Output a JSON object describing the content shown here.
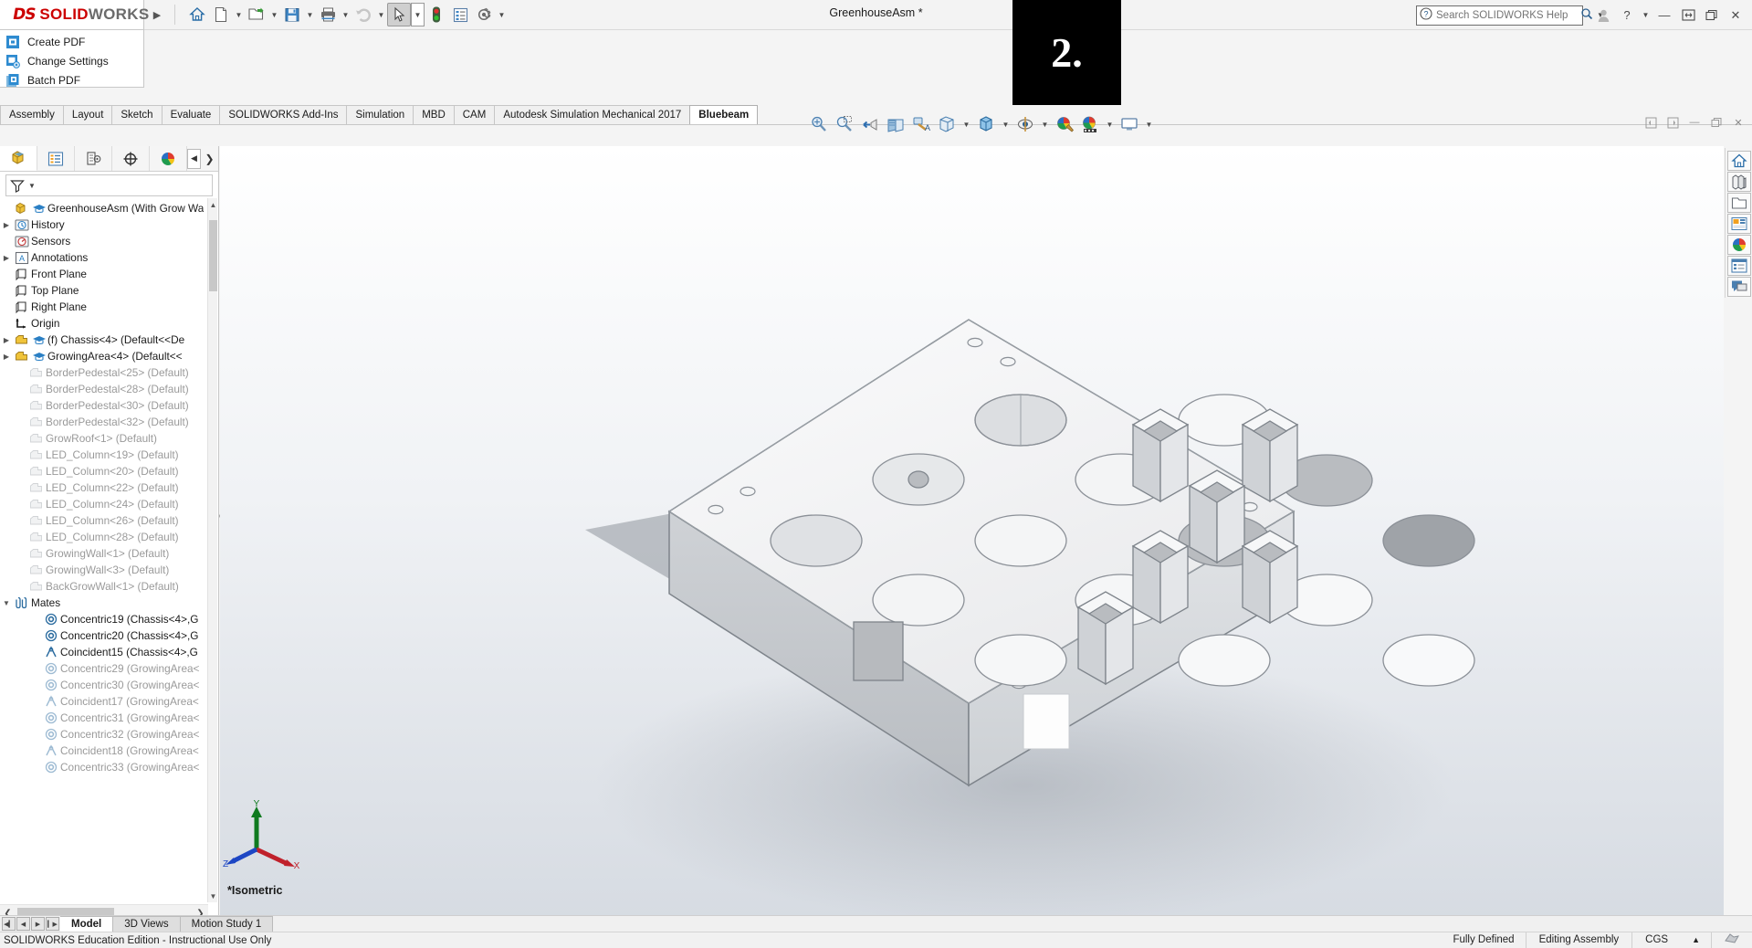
{
  "window": {
    "brand_ds": "DS",
    "brand_solid": "SOLID",
    "brand_works": "WORKS",
    "document_title": "GreenhouseAsm *",
    "search_placeholder": "Search SOLIDWORKS Help",
    "overlay_badge": "2."
  },
  "logo_menu": {
    "items": [
      {
        "label": "Create PDF",
        "icon": "pdf-document-icon"
      },
      {
        "label": "Change Settings",
        "icon": "settings-gear-icon"
      },
      {
        "label": "Batch PDF",
        "icon": "batch-pdf-icon"
      }
    ]
  },
  "main_toolbar": {
    "buttons": [
      {
        "name": "home-icon",
        "tooltip": "Home"
      },
      {
        "name": "new-document-icon",
        "tooltip": "New"
      },
      {
        "name": "open-folder-icon",
        "tooltip": "Open"
      },
      {
        "name": "save-icon",
        "tooltip": "Save"
      },
      {
        "name": "print-icon",
        "tooltip": "Print"
      },
      {
        "name": "undo-icon",
        "tooltip": "Undo"
      },
      {
        "name": "select-cursor-icon",
        "tooltip": "Select"
      },
      {
        "name": "rebuild-traffic-light-icon",
        "tooltip": "Rebuild"
      },
      {
        "name": "options-list-icon",
        "tooltip": "Options"
      },
      {
        "name": "settings-gear-icon",
        "tooltip": "Settings"
      }
    ]
  },
  "command_tabs": {
    "items": [
      {
        "label": "Assembly",
        "active": false
      },
      {
        "label": "Layout",
        "active": false
      },
      {
        "label": "Sketch",
        "active": false
      },
      {
        "label": "Evaluate",
        "active": false
      },
      {
        "label": "SOLIDWORKS Add-Ins",
        "active": false
      },
      {
        "label": "Simulation",
        "active": false
      },
      {
        "label": "MBD",
        "active": false
      },
      {
        "label": "CAM",
        "active": false
      },
      {
        "label": "Autodesk Simulation Mechanical 2017",
        "active": false
      },
      {
        "label": "Bluebeam",
        "active": true
      }
    ]
  },
  "view_toolbar": {
    "buttons": [
      {
        "name": "zoom-to-fit-icon"
      },
      {
        "name": "zoom-to-area-icon"
      },
      {
        "name": "previous-view-icon"
      },
      {
        "name": "section-view-icon"
      },
      {
        "name": "view-orientation-paint-icon"
      },
      {
        "name": "view-orientation-cube-icon"
      },
      {
        "name": "display-style-icon"
      },
      {
        "name": "hide-show-items-icon"
      },
      {
        "name": "edit-appearance-icon"
      },
      {
        "name": "apply-scene-icon"
      },
      {
        "name": "view-settings-icon"
      }
    ]
  },
  "document_window_buttons": [
    {
      "name": "restore-left-icon"
    },
    {
      "name": "restore-right-icon"
    },
    {
      "name": "minimize-icon"
    },
    {
      "name": "maximize-icon"
    },
    {
      "name": "close-icon"
    }
  ],
  "feature_manager": {
    "tabs": [
      {
        "name": "feature-manager-tree-tab",
        "active": true
      },
      {
        "name": "property-manager-tab",
        "active": false
      },
      {
        "name": "configuration-manager-tab",
        "active": false
      },
      {
        "name": "dimxpert-manager-tab",
        "active": false
      },
      {
        "name": "display-manager-tab",
        "active": false
      }
    ],
    "filter_placeholder": "",
    "tree": [
      {
        "label": "GreenhouseAsm  (With Grow Wa",
        "icon": "assembly-icon",
        "icon2": "education-cap-icon",
        "expandable": false,
        "indent": 0,
        "dim": false
      },
      {
        "label": "History",
        "icon": "history-icon",
        "expandable": true,
        "indent": 0,
        "dim": false
      },
      {
        "label": "Sensors",
        "icon": "sensors-icon",
        "expandable": false,
        "indent": 0,
        "dim": false
      },
      {
        "label": "Annotations",
        "icon": "annotations-icon",
        "expandable": true,
        "indent": 0,
        "dim": false
      },
      {
        "label": "Front Plane",
        "icon": "plane-icon",
        "expandable": false,
        "indent": 0,
        "dim": false
      },
      {
        "label": "Top Plane",
        "icon": "plane-icon",
        "expandable": false,
        "indent": 0,
        "dim": false
      },
      {
        "label": "Right Plane",
        "icon": "plane-icon",
        "expandable": false,
        "indent": 0,
        "dim": false
      },
      {
        "label": "Origin",
        "icon": "origin-icon",
        "expandable": false,
        "indent": 0,
        "dim": false
      },
      {
        "label": "(f) Chassis<4> (Default<<De",
        "icon": "part-icon",
        "icon2": "education-cap-icon",
        "expandable": true,
        "indent": 0,
        "dim": false
      },
      {
        "label": "GrowingArea<4> (Default<<",
        "icon": "part-icon",
        "icon2": "education-cap-icon",
        "expandable": true,
        "indent": 0,
        "dim": false
      },
      {
        "label": "BorderPedestal<25> (Default)",
        "icon": "part-gray-icon",
        "expandable": false,
        "indent": 1,
        "dim": true
      },
      {
        "label": "BorderPedestal<28> (Default)",
        "icon": "part-gray-icon",
        "expandable": false,
        "indent": 1,
        "dim": true
      },
      {
        "label": "BorderPedestal<30> (Default)",
        "icon": "part-gray-icon",
        "expandable": false,
        "indent": 1,
        "dim": true
      },
      {
        "label": "BorderPedestal<32> (Default)",
        "icon": "part-gray-icon",
        "expandable": false,
        "indent": 1,
        "dim": true
      },
      {
        "label": "GrowRoof<1> (Default)",
        "icon": "part-gray-icon",
        "expandable": false,
        "indent": 1,
        "dim": true
      },
      {
        "label": "LED_Column<19> (Default)",
        "icon": "part-gray-icon",
        "expandable": false,
        "indent": 1,
        "dim": true
      },
      {
        "label": "LED_Column<20> (Default)",
        "icon": "part-gray-icon",
        "expandable": false,
        "indent": 1,
        "dim": true
      },
      {
        "label": "LED_Column<22> (Default)",
        "icon": "part-gray-icon",
        "expandable": false,
        "indent": 1,
        "dim": true
      },
      {
        "label": "LED_Column<24> (Default)",
        "icon": "part-gray-icon",
        "expandable": false,
        "indent": 1,
        "dim": true
      },
      {
        "label": "LED_Column<26> (Default)",
        "icon": "part-gray-icon",
        "expandable": false,
        "indent": 1,
        "dim": true
      },
      {
        "label": "LED_Column<28> (Default)",
        "icon": "part-gray-icon",
        "expandable": false,
        "indent": 1,
        "dim": true
      },
      {
        "label": "GrowingWall<1> (Default)",
        "icon": "part-gray-icon",
        "expandable": false,
        "indent": 1,
        "dim": true
      },
      {
        "label": "GrowingWall<3> (Default)",
        "icon": "part-gray-icon",
        "expandable": false,
        "indent": 1,
        "dim": true
      },
      {
        "label": "BackGrowWall<1> (Default)",
        "icon": "part-gray-icon",
        "expandable": false,
        "indent": 1,
        "dim": true
      },
      {
        "label": "Mates",
        "icon": "mates-icon",
        "expandable": true,
        "expanded": true,
        "indent": 0,
        "dim": false
      },
      {
        "label": "Concentric19 (Chassis<4>,G",
        "icon": "concentric-mate-icon",
        "expandable": false,
        "indent": 2,
        "dim": false
      },
      {
        "label": "Concentric20 (Chassis<4>,G",
        "icon": "concentric-mate-icon",
        "expandable": false,
        "indent": 2,
        "dim": false
      },
      {
        "label": "Coincident15 (Chassis<4>,G",
        "icon": "coincident-mate-icon",
        "expandable": false,
        "indent": 2,
        "dim": false
      },
      {
        "label": "Concentric29 (GrowingArea<",
        "icon": "concentric-mate-icon",
        "expandable": false,
        "indent": 2,
        "dim": true
      },
      {
        "label": "Concentric30 (GrowingArea<",
        "icon": "concentric-mate-icon",
        "expandable": false,
        "indent": 2,
        "dim": true
      },
      {
        "label": "Coincident17 (GrowingArea<",
        "icon": "coincident-mate-icon",
        "expandable": false,
        "indent": 2,
        "dim": true
      },
      {
        "label": "Concentric31 (GrowingArea<",
        "icon": "concentric-mate-icon",
        "expandable": false,
        "indent": 2,
        "dim": true
      },
      {
        "label": "Concentric32 (GrowingArea<",
        "icon": "concentric-mate-icon",
        "expandable": false,
        "indent": 2,
        "dim": true
      },
      {
        "label": "Coincident18 (GrowingArea<",
        "icon": "coincident-mate-icon",
        "expandable": false,
        "indent": 2,
        "dim": true
      },
      {
        "label": "Concentric33 (GrowingArea<",
        "icon": "concentric-mate-icon",
        "expandable": false,
        "indent": 2,
        "dim": true
      }
    ]
  },
  "viewport": {
    "view_label": "*Isometric",
    "triad_axes": {
      "x": "X",
      "y": "Y",
      "z": "Z"
    }
  },
  "task_pane": {
    "buttons": [
      {
        "name": "solidworks-resources-home-icon"
      },
      {
        "name": "design-library-icon"
      },
      {
        "name": "file-explorer-folder-icon"
      },
      {
        "name": "view-palette-icon"
      },
      {
        "name": "appearances-scenes-icon"
      },
      {
        "name": "custom-properties-icon"
      },
      {
        "name": "solidworks-forum-icon"
      }
    ]
  },
  "bottom_tabs": {
    "nav_buttons": [
      "first",
      "previous",
      "next",
      "last"
    ],
    "items": [
      {
        "label": "Model",
        "active": true
      },
      {
        "label": "3D Views",
        "active": false
      },
      {
        "label": "Motion Study 1",
        "active": false
      }
    ]
  },
  "status_bar": {
    "left_text": "SOLIDWORKS Education Edition - Instructional Use Only",
    "state": "Fully Defined",
    "editing": "Editing Assembly",
    "units": "CGS",
    "units_caret": "▲"
  },
  "colors": {
    "brand_red": "#cc0000",
    "accent_blue": "#2b5f8f",
    "panel_bg": "#f3f3f3",
    "tab_active": "#ffffff",
    "dim_text": "#9a9a9a"
  }
}
